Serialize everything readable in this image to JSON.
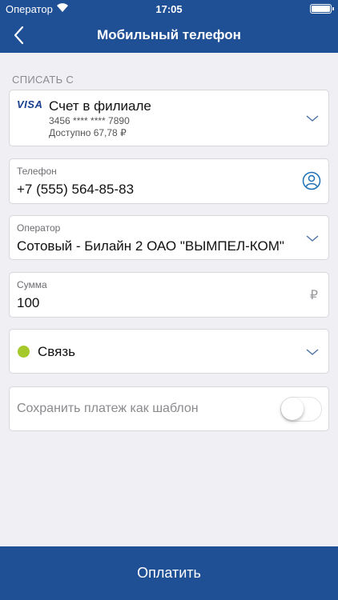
{
  "status_bar": {
    "carrier": "Оператор",
    "time": "17:05"
  },
  "header": {
    "title": "Мобильный телефон",
    "back_icon": "chevron-left-icon"
  },
  "source": {
    "section_label": "СПИСАТЬ С",
    "card_brand": "VISA",
    "account_name": "Счет в филиале",
    "account_number": "3456 **** **** 7890",
    "available": "Доступно 67,78 ₽"
  },
  "phone": {
    "label": "Телефон",
    "value": "+7 (555) 564-85-83",
    "icon": "contact-icon"
  },
  "operator": {
    "label": "Оператор",
    "value": "Сотовый - Билайн 2 ОАО \"ВЫМПЕЛ-КОМ\""
  },
  "amount": {
    "label": "Сумма",
    "value": "100",
    "currency": "₽"
  },
  "category": {
    "label": "Связь",
    "dot_color": "#a5c82a"
  },
  "template": {
    "label": "Сохранить платеж как шаблон",
    "enabled": false
  },
  "pay_button": {
    "label": "Оплатить"
  },
  "colors": {
    "header": "#1f4f95",
    "background": "#efeff4",
    "accent": "#1a6fb5"
  }
}
